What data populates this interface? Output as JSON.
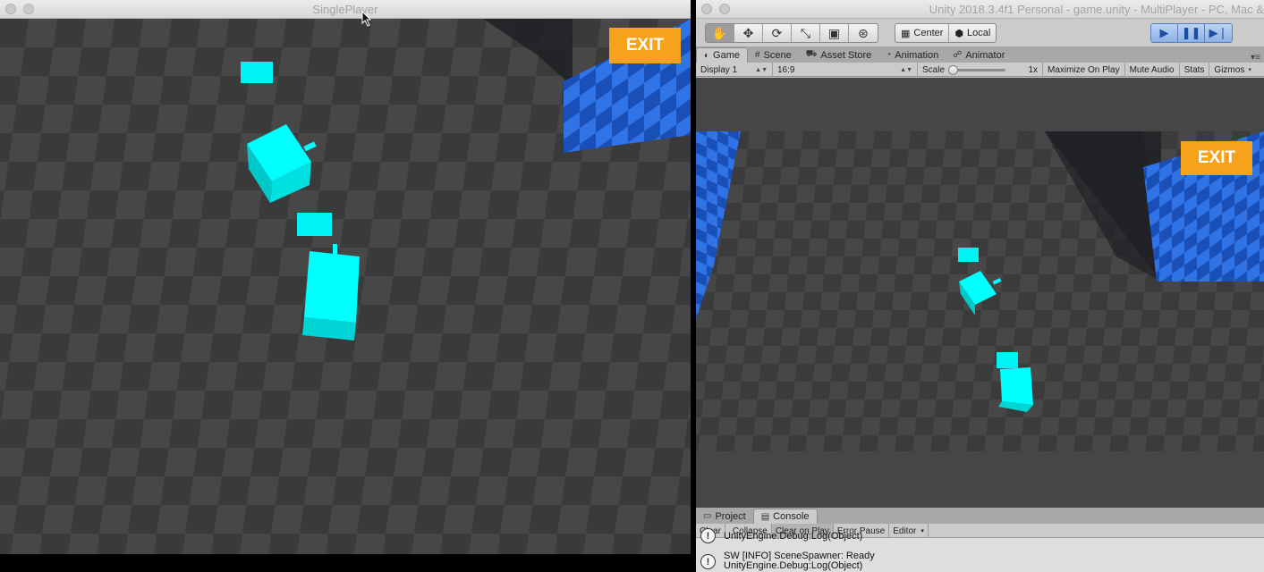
{
  "left_window": {
    "title": "SinglePlayer",
    "exit_label": "EXIT"
  },
  "right_window": {
    "title": "Unity 2018.3.4f1 Personal - game.unity - MultiPlayer - PC, Mac &",
    "toolbar": {
      "tools": [
        "hand-icon",
        "move-icon",
        "rotate-icon",
        "scale-icon",
        "rect-icon",
        "transform-icon"
      ],
      "pivot_label": "Center",
      "space_label": "Local",
      "play_icons": [
        "play-icon",
        "pause-icon",
        "step-icon"
      ]
    },
    "tabs": [
      {
        "label": "Game",
        "icon": "game-icon",
        "active": true
      },
      {
        "label": "Scene",
        "icon": "scene-icon",
        "active": false
      },
      {
        "label": "Asset Store",
        "icon": "store-icon",
        "active": false
      },
      {
        "label": "Animation",
        "icon": "animation-icon",
        "active": false
      },
      {
        "label": "Animator",
        "icon": "animator-icon",
        "active": false
      }
    ],
    "game_bar": {
      "display": "Display 1",
      "aspect": "16:9",
      "scale_label": "Scale",
      "scale_value": "1x",
      "maximize": "Maximize On Play",
      "mute": "Mute Audio",
      "stats": "Stats",
      "gizmos": "Gizmos"
    },
    "exit_label": "EXIT",
    "console_tabs": [
      {
        "label": "Project",
        "icon": "folder-icon",
        "active": false
      },
      {
        "label": "Console",
        "icon": "console-icon",
        "active": true
      }
    ],
    "console_bar": {
      "clear": "Clear",
      "collapse": "Collapse",
      "clear_on_play": "Clear on Play",
      "error_pause": "Error Pause",
      "editor": "Editor"
    },
    "logs": [
      {
        "line1": "",
        "line2": "UnityEngine.Debug:Log(Object)"
      },
      {
        "line1": "SW [INFO] SceneSpawner: Ready",
        "line2": "UnityEngine.Debug:Log(Object)"
      }
    ]
  },
  "colors": {
    "exit": "#f7a21b",
    "cube": "#00ffff",
    "floor_dark": "#3c3c3c",
    "floor_light": "#4d4d4d",
    "wall_blue": "#1f5fd6"
  }
}
